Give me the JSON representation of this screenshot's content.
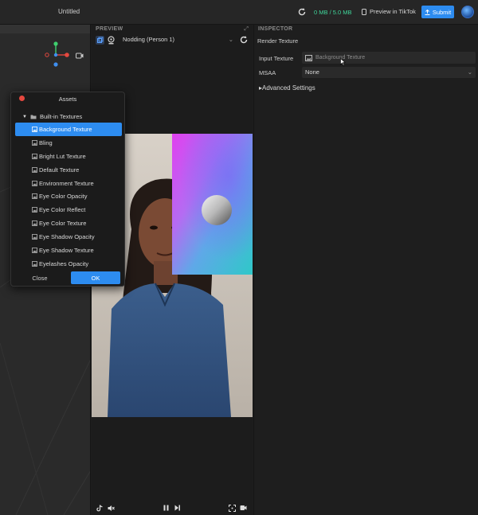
{
  "app": {
    "title": "Untitled",
    "memory": "0 MB / 5.0 MB",
    "preview_label": "Preview in TikTok",
    "submit_label": "Submit"
  },
  "preview": {
    "header": "PREVIEW",
    "person_select": "Nodding (Person 1)"
  },
  "inspector": {
    "header": "INSPECTOR",
    "section_title": "Render Texture",
    "input_texture_label": "Input Texture",
    "input_texture_value": "Background Texture",
    "msaa_label": "MSAA",
    "msaa_value": "None",
    "advanced_label": "Advanced Settings"
  },
  "assets_dialog": {
    "title": "Assets",
    "folder": "Built-in Textures",
    "items": [
      "Background Texture",
      "Bling",
      "Bright Lut Texture",
      "Default Texture",
      "Environment Texture",
      "Eye Color Opacity",
      "Eye Color Reflect",
      "Eye Color Texture",
      "Eye Shadow Opacity",
      "Eye Shadow Texture",
      "Eyelashes Opacity"
    ],
    "selected_index": 0,
    "close_label": "Close",
    "ok_label": "OK"
  },
  "colors": {
    "accent": "#2d8cf0",
    "memory_green": "#3fd69a",
    "gizmo_red": "#e5483f",
    "gizmo_green": "#3fcf6e",
    "gizmo_blue": "#3f8ff0"
  }
}
